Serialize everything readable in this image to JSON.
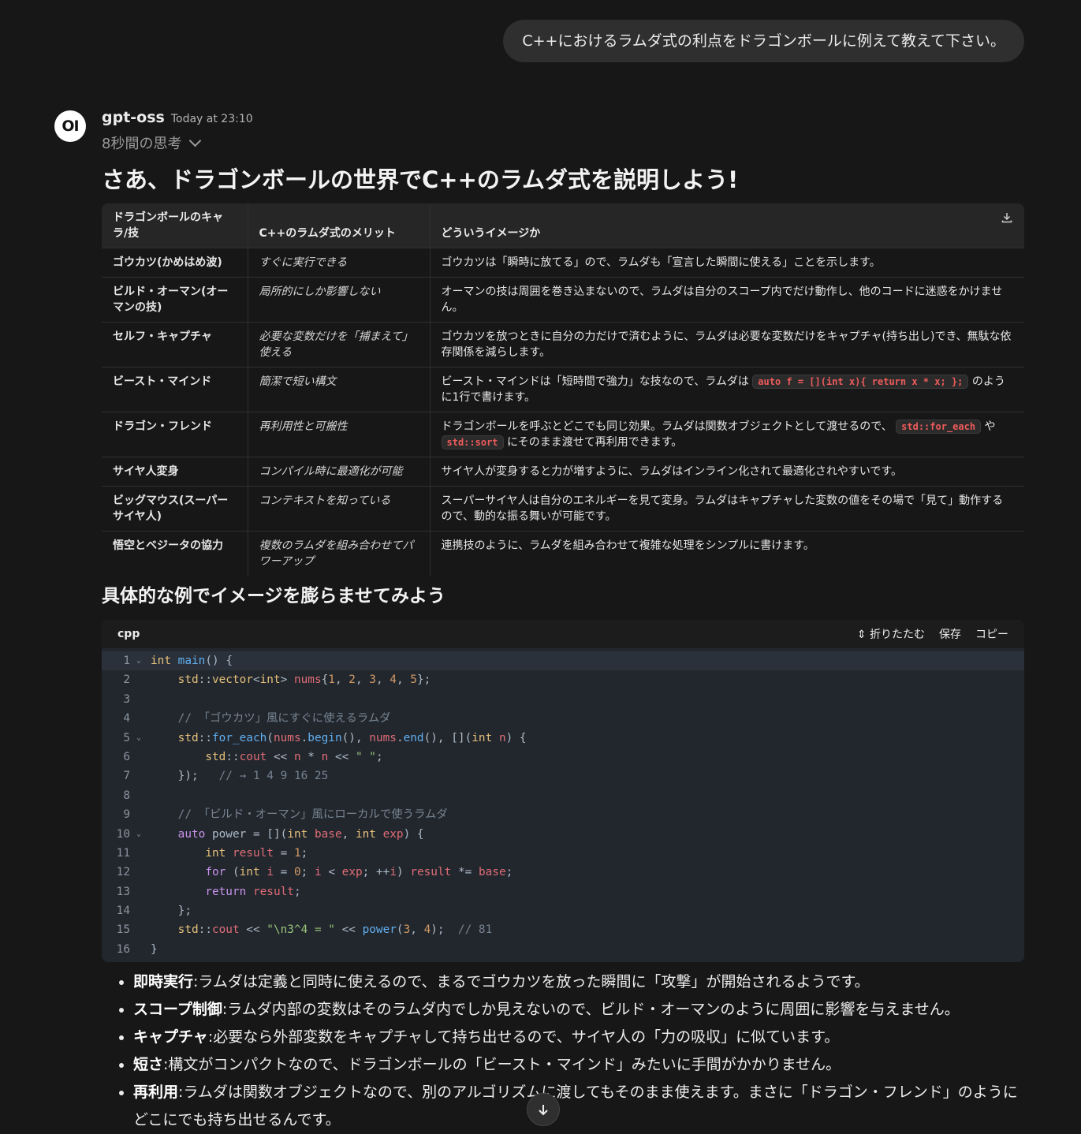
{
  "user_message": "C++におけるラムダ式の利点をドラゴンボールに例えて教えて下さい。",
  "assistant": {
    "avatar_text": "OI",
    "model_name": "gpt-oss",
    "timestamp": "Today at 23:10",
    "thinking_label": "8秒間の思考",
    "title": "さあ、ドラゴンボールの世界でC++のラムダ式を説明しよう!",
    "table": {
      "headers": [
        "ドラゴンボールのキャラ/技",
        "C++のラムダ式のメリット",
        "どういうイメージか"
      ],
      "rows": [
        {
          "c1": "ゴウカツ(かめはめ波)",
          "c2": "すぐに実行できる",
          "c3a": "ゴウカツは「瞬時に放てる」ので、ラムダも「宣言した瞬間に使える」ことを示します。"
        },
        {
          "c1": "ビルド・オーマン(オーマンの技)",
          "c2": "局所的にしか影響しない",
          "c3a": "オーマンの技は周囲を巻き込まないので、ラムダは自分のスコープ内でだけ動作し、他のコードに迷惑をかけません。"
        },
        {
          "c1": "セルフ・キャプチャ",
          "c2": "必要な変数だけを「捕まえて」使える",
          "c3a": "ゴウカツを放つときに自分の力だけで済むように、ラムダは必要な変数だけをキャプチャ(持ち出し)でき、無駄な依存関係を減らします。"
        },
        {
          "c1": "ビースト・マインド",
          "c2": "簡潔で短い構文",
          "c3a": "ビースト・マインドは「短時間で強力」な技なので、ラムダは",
          "code1": "auto f = [](int x){ return x * x; };",
          "c3b": "のように1行で書けます。"
        },
        {
          "c1": "ドラゴン・フレンド",
          "c2": "再利用性と可搬性",
          "c3a": "ドラゴンボールを呼ぶとどこでも同じ効果。ラムダは関数オブジェクトとして渡せるので、",
          "code1": "std::for_each",
          "c3b": "や",
          "code2": "std::sort",
          "c3c": "にそのまま渡せて再利用できます。"
        },
        {
          "c1": "サイヤ人変身",
          "c2": "コンパイル時に最適化が可能",
          "c3a": "サイヤ人が変身すると力が増すように、ラムダはインライン化されて最適化されやすいです。"
        },
        {
          "c1": "ビッグマウス(スーパーサイヤ人)",
          "c2": "コンテキストを知っている",
          "c3a": "スーパーサイヤ人は自分のエネルギーを見て変身。ラムダはキャプチャした変数の値をその場で「見て」動作するので、動的な振る舞いが可能です。"
        },
        {
          "c1": "悟空とベジータの協力",
          "c2": "複数のラムダを組み合わせてパワーアップ",
          "c3a": "連携技のように、ラムダを組み合わせて複雑な処理をシンプルに書けます。"
        }
      ]
    },
    "subtitle": "具体的な例でイメージを膨らませてみよう",
    "code": {
      "lang": "cpp",
      "fold_label": "折りたたむ",
      "save_label": "保存",
      "copy_label": "コピー",
      "lines": [
        "int main() {",
        "    std::vector<int> nums{1, 2, 3, 4, 5};",
        "",
        "    // 「ゴウカツ」風にすぐに使えるラムダ",
        "    std::for_each(nums.begin(), nums.end(), [](int n) {",
        "        std::cout << n * n << \" \";",
        "    });   // → 1 4 9 16 25",
        "",
        "    // 「ビルド・オーマン」風にローカルで使うラムダ",
        "    auto power = [](int base, int exp) {",
        "        int result = 1;",
        "        for (int i = 0; i < exp; ++i) result *= base;",
        "        return result;",
        "    };",
        "    std::cout << \"\\n3^4 = \" << power(3, 4);  // 81",
        "}"
      ]
    },
    "bullets": [
      {
        "term": "即時実行",
        "text": ":ラムダは定義と同時に使えるので、まるでゴウカツを放った瞬間に「攻撃」が開始されるようです。"
      },
      {
        "term": "スコープ制御",
        "text": ":ラムダ内部の変数はそのラムダ内でしか見えないので、ビルド・オーマンのように周囲に影響を与えません。"
      },
      {
        "term": "キャプチャ",
        "text": ":必要なら外部変数をキャプチャして持ち出せるので、サイヤ人の「力の吸収」に似ています。"
      },
      {
        "term": "短さ",
        "text": ":構文がコンパクトなので、ドラゴンボールの「ビースト・マインド」みたいに手間がかかりません。"
      },
      {
        "term": "再利用",
        "text": ":ラムダは関数オブジェクトなので、別のアルゴリズムに渡してもそのまま使えます。まさに「ドラゴン・フレンド」のようにどこにでも持ち出せるんです。"
      }
    ]
  }
}
